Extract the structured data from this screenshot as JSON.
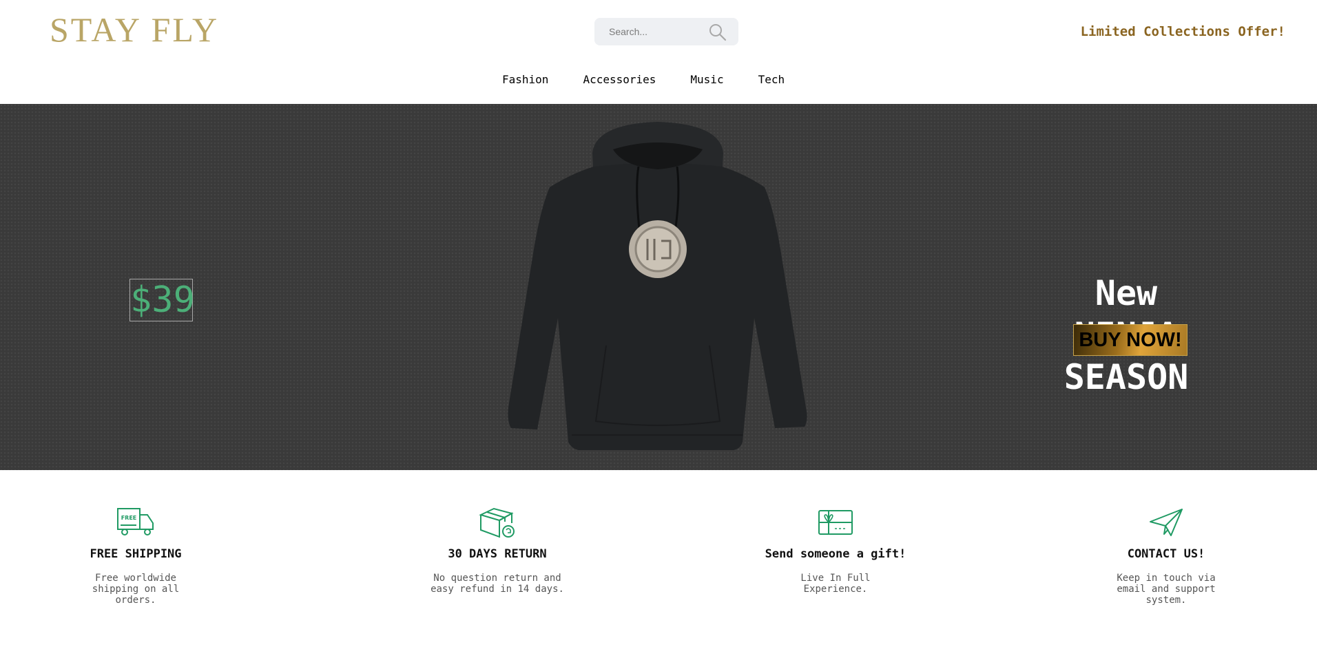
{
  "header": {
    "logo": "STAY FLY",
    "search_placeholder": "Search...",
    "offer": "Limited Collections Offer!"
  },
  "nav": [
    "Fashion",
    "Accessories",
    "Music",
    "Tech"
  ],
  "hero": {
    "price": "$39",
    "headline_1": "New",
    "headline_2": "NINJA",
    "headline_3": "SEASON",
    "buy_label": "BUY NOW!"
  },
  "features": [
    {
      "icon": "truck-icon",
      "title": "FREE SHIPPING",
      "text": "Free worldwide shipping on all orders.",
      "badge": "FREE"
    },
    {
      "icon": "return-box-icon",
      "title": "30 DAYS RETURN",
      "text": "No question return and easy refund in 14 days."
    },
    {
      "icon": "gift-card-icon",
      "title": "Send someone a gift!",
      "text": "Live In Full Experience."
    },
    {
      "icon": "paper-plane-icon",
      "title": "CONTACT US!",
      "text": "Keep in touch via email and support system."
    }
  ],
  "colors": {
    "logo": "#b9a566",
    "accent": "#8a6420",
    "price": "#4caf78",
    "icon": "#1f9a63"
  }
}
